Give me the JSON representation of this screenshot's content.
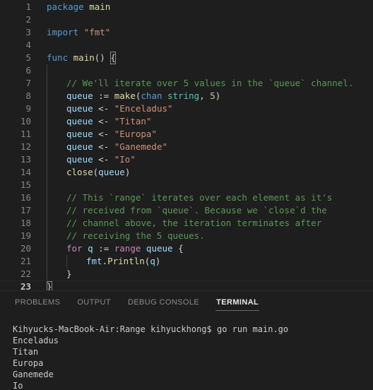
{
  "editor": {
    "language": "go",
    "active_line": 23,
    "lines": [
      {
        "n": 1,
        "indent": 0,
        "tokens": [
          {
            "t": "package",
            "c": "kw"
          },
          {
            "t": " ",
            "c": "pun"
          },
          {
            "t": "main",
            "c": "fn"
          }
        ]
      },
      {
        "n": 2,
        "indent": 0,
        "tokens": []
      },
      {
        "n": 3,
        "indent": 0,
        "tokens": [
          {
            "t": "import",
            "c": "kw"
          },
          {
            "t": " ",
            "c": "pun"
          },
          {
            "t": "\"fmt\"",
            "c": "str"
          }
        ]
      },
      {
        "n": 4,
        "indent": 0,
        "tokens": []
      },
      {
        "n": 5,
        "indent": 0,
        "tokens": [
          {
            "t": "func",
            "c": "kw"
          },
          {
            "t": " ",
            "c": "pun"
          },
          {
            "t": "main",
            "c": "fn"
          },
          {
            "t": "() ",
            "c": "pun"
          },
          {
            "t": "{",
            "c": "pun",
            "box": true
          }
        ]
      },
      {
        "n": 6,
        "indent": 1,
        "tokens": []
      },
      {
        "n": 7,
        "indent": 1,
        "tokens": [
          {
            "t": "// We'll iterate over 5 values in the `queue` channel.",
            "c": "cmt"
          }
        ]
      },
      {
        "n": 8,
        "indent": 1,
        "tokens": [
          {
            "t": "queue",
            "c": "var"
          },
          {
            "t": " := ",
            "c": "pun"
          },
          {
            "t": "make",
            "c": "fn"
          },
          {
            "t": "(",
            "c": "pun"
          },
          {
            "t": "chan",
            "c": "kw"
          },
          {
            "t": " ",
            "c": "pun"
          },
          {
            "t": "string",
            "c": "type"
          },
          {
            "t": ", ",
            "c": "pun"
          },
          {
            "t": "5",
            "c": "num"
          },
          {
            "t": ")",
            "c": "pun"
          }
        ]
      },
      {
        "n": 9,
        "indent": 1,
        "tokens": [
          {
            "t": "queue",
            "c": "var"
          },
          {
            "t": " <- ",
            "c": "pun"
          },
          {
            "t": "\"Enceladus\"",
            "c": "str"
          }
        ]
      },
      {
        "n": 10,
        "indent": 1,
        "tokens": [
          {
            "t": "queue",
            "c": "var"
          },
          {
            "t": " <- ",
            "c": "pun"
          },
          {
            "t": "\"Titan\"",
            "c": "str"
          }
        ]
      },
      {
        "n": 11,
        "indent": 1,
        "tokens": [
          {
            "t": "queue",
            "c": "var"
          },
          {
            "t": " <- ",
            "c": "pun"
          },
          {
            "t": "\"Europa\"",
            "c": "str"
          }
        ]
      },
      {
        "n": 12,
        "indent": 1,
        "tokens": [
          {
            "t": "queue",
            "c": "var"
          },
          {
            "t": " <- ",
            "c": "pun"
          },
          {
            "t": "\"Ganemede\"",
            "c": "str"
          }
        ]
      },
      {
        "n": 13,
        "indent": 1,
        "tokens": [
          {
            "t": "queue",
            "c": "var"
          },
          {
            "t": " <- ",
            "c": "pun"
          },
          {
            "t": "\"Io\"",
            "c": "str"
          }
        ]
      },
      {
        "n": 14,
        "indent": 1,
        "tokens": [
          {
            "t": "close",
            "c": "fn"
          },
          {
            "t": "(",
            "c": "pun"
          },
          {
            "t": "queue",
            "c": "var"
          },
          {
            "t": ")",
            "c": "pun"
          }
        ]
      },
      {
        "n": 15,
        "indent": 1,
        "tokens": []
      },
      {
        "n": 16,
        "indent": 1,
        "tokens": [
          {
            "t": "// This `range` iterates over each element as it's",
            "c": "cmt"
          }
        ]
      },
      {
        "n": 17,
        "indent": 1,
        "tokens": [
          {
            "t": "// received from `queue`. Because we `close`d the",
            "c": "cmt"
          }
        ]
      },
      {
        "n": 18,
        "indent": 1,
        "tokens": [
          {
            "t": "// channel above, the iteration terminates after",
            "c": "cmt"
          }
        ]
      },
      {
        "n": 19,
        "indent": 1,
        "tokens": [
          {
            "t": "// receiving the 5 queues.",
            "c": "cmt"
          }
        ]
      },
      {
        "n": 20,
        "indent": 1,
        "tokens": [
          {
            "t": "for",
            "c": "kw2"
          },
          {
            "t": " ",
            "c": "pun"
          },
          {
            "t": "q",
            "c": "var"
          },
          {
            "t": " := ",
            "c": "pun"
          },
          {
            "t": "range",
            "c": "kw2"
          },
          {
            "t": " ",
            "c": "pun"
          },
          {
            "t": "queue",
            "c": "var"
          },
          {
            "t": " {",
            "c": "pun"
          }
        ]
      },
      {
        "n": 21,
        "indent": 2,
        "tokens": [
          {
            "t": "fmt",
            "c": "var"
          },
          {
            "t": ".",
            "c": "pun"
          },
          {
            "t": "Println",
            "c": "fn"
          },
          {
            "t": "(",
            "c": "pun"
          },
          {
            "t": "q",
            "c": "var"
          },
          {
            "t": ")",
            "c": "pun"
          }
        ]
      },
      {
        "n": 22,
        "indent": 1,
        "tokens": [
          {
            "t": "}",
            "c": "pun"
          }
        ]
      },
      {
        "n": 23,
        "indent": 0,
        "tokens": [
          {
            "t": "}",
            "c": "pun",
            "box": true
          }
        ]
      }
    ]
  },
  "panel": {
    "tabs": [
      {
        "label": "PROBLEMS",
        "active": false
      },
      {
        "label": "OUTPUT",
        "active": false
      },
      {
        "label": "DEBUG CONSOLE",
        "active": false
      },
      {
        "label": "TERMINAL",
        "active": true
      }
    ],
    "terminal": {
      "lines": [
        "Kihyucks-MacBook-Air:Range kihyuckhong$ go run main.go",
        "Enceladus",
        "Titan",
        "Europa",
        "Ganemede",
        "Io"
      ]
    }
  },
  "colors": {
    "background": "#1e1e1e",
    "line_number": "#858585",
    "active_line_number": "#c6c6c6",
    "keyword": "#569cd6",
    "control_keyword": "#c586c0",
    "function": "#dcdcaa",
    "string": "#ce9178",
    "comment": "#5a9955",
    "variable": "#9cdcfe",
    "type": "#4ec9b0",
    "number": "#b5cea8",
    "punctuation": "#d4d4d4",
    "terminal_text": "#cccccc"
  }
}
